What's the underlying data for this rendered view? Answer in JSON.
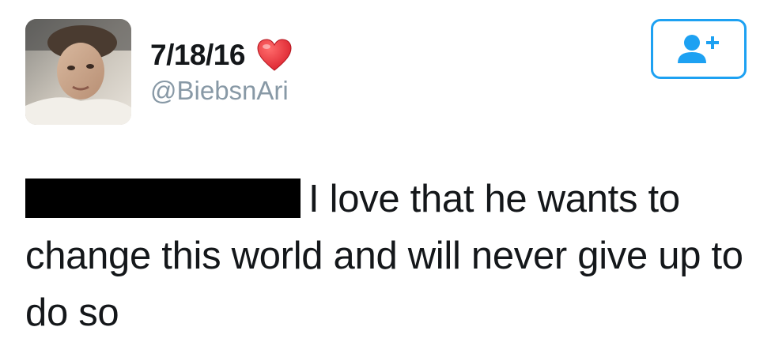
{
  "tweet": {
    "display_name": "7/18/16",
    "handle": "@BiebsnAri",
    "text_after_redaction": "I love that he wants to change this world and will never give up to do so"
  },
  "icons": {
    "name_emoji": "red-heart-icon",
    "follow": "follow-person-plus-icon"
  },
  "colors": {
    "accent": "#1da1f2",
    "handle": "#8899a6",
    "text": "#14171a",
    "heart": "#e0245e",
    "redaction": "#000000"
  }
}
